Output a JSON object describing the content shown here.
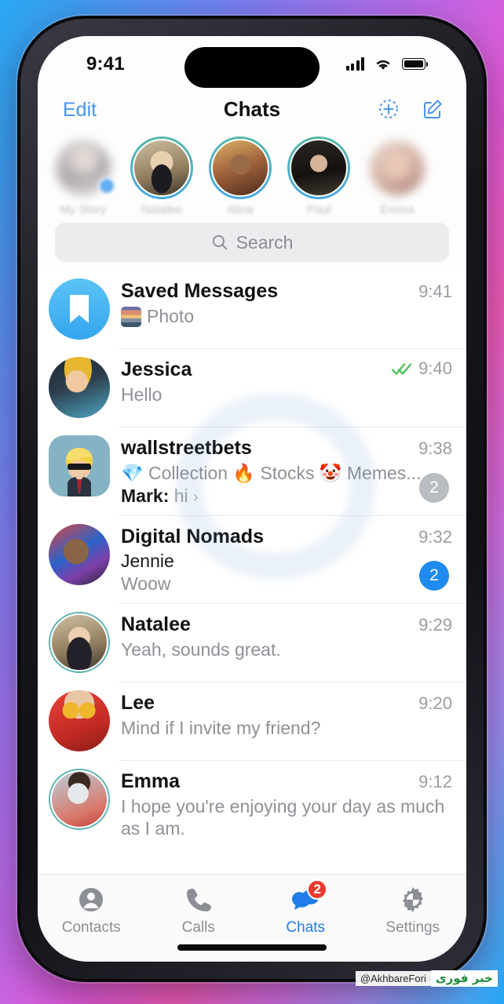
{
  "status_bar": {
    "time": "9:41",
    "signal_icon": "cellular-signal-icon",
    "wifi_icon": "wifi-icon",
    "battery_icon": "battery-icon"
  },
  "nav": {
    "edit_label": "Edit",
    "title": "Chats",
    "add_story_icon": "add-story-icon",
    "compose_icon": "compose-icon"
  },
  "stories": [
    {
      "name": "My Story",
      "has_ring": false,
      "blurred": true
    },
    {
      "name": "Natalee",
      "has_ring": true,
      "blurred": false
    },
    {
      "name": "Alina",
      "has_ring": true,
      "blurred": false
    },
    {
      "name": "Paul",
      "has_ring": true,
      "blurred": false
    },
    {
      "name": "Emma",
      "has_ring": false,
      "blurred": true
    }
  ],
  "search": {
    "placeholder": "Search",
    "icon": "search-icon"
  },
  "chats": [
    {
      "title": "Saved Messages",
      "preview": "Photo",
      "time": "9:41",
      "has_photo_thumb": true,
      "avatar_type": "bookmark-icon"
    },
    {
      "title": "Jessica",
      "preview": "Hello",
      "time": "9:40",
      "read_ticks": true
    },
    {
      "title": "wallstreetbets",
      "topics": "💎 Collection 🔥 Stocks 🤡 Memes...",
      "sender": "Mark:",
      "fragment": "hi",
      "time": "9:38",
      "badge": "2",
      "badge_muted": true
    },
    {
      "title": "Digital Nomads",
      "sender_line": "Jennie",
      "preview": "Woow",
      "time": "9:32",
      "badge": "2",
      "badge_muted": false
    },
    {
      "title": "Natalee",
      "preview": "Yeah, sounds great.",
      "time": "9:29"
    },
    {
      "title": "Lee",
      "preview": "Mind if I invite my friend?",
      "time": "9:20"
    },
    {
      "title": "Emma",
      "preview": "I hope you're enjoying your day as much as I am.",
      "time": "9:12"
    }
  ],
  "tabs": [
    {
      "label": "Contacts",
      "icon": "contacts-icon",
      "active": false,
      "badge": ""
    },
    {
      "label": "Calls",
      "icon": "phone-icon",
      "active": false,
      "badge": ""
    },
    {
      "label": "Chats",
      "icon": "chat-bubbles-icon",
      "active": true,
      "badge": "2"
    },
    {
      "label": "Settings",
      "icon": "gear-icon",
      "active": false,
      "badge": ""
    }
  ],
  "watermark": {
    "handle": "@AkhbareFori",
    "logo": "خبر فوری"
  },
  "colors": {
    "accent_blue": "#1f8bf0",
    "nav_blue": "#4a94e8",
    "badge_red": "#ea3b2e",
    "badge_muted": "#b9bcc1",
    "tick_green": "#4fc25a",
    "story_ring": "#53b9a4"
  }
}
